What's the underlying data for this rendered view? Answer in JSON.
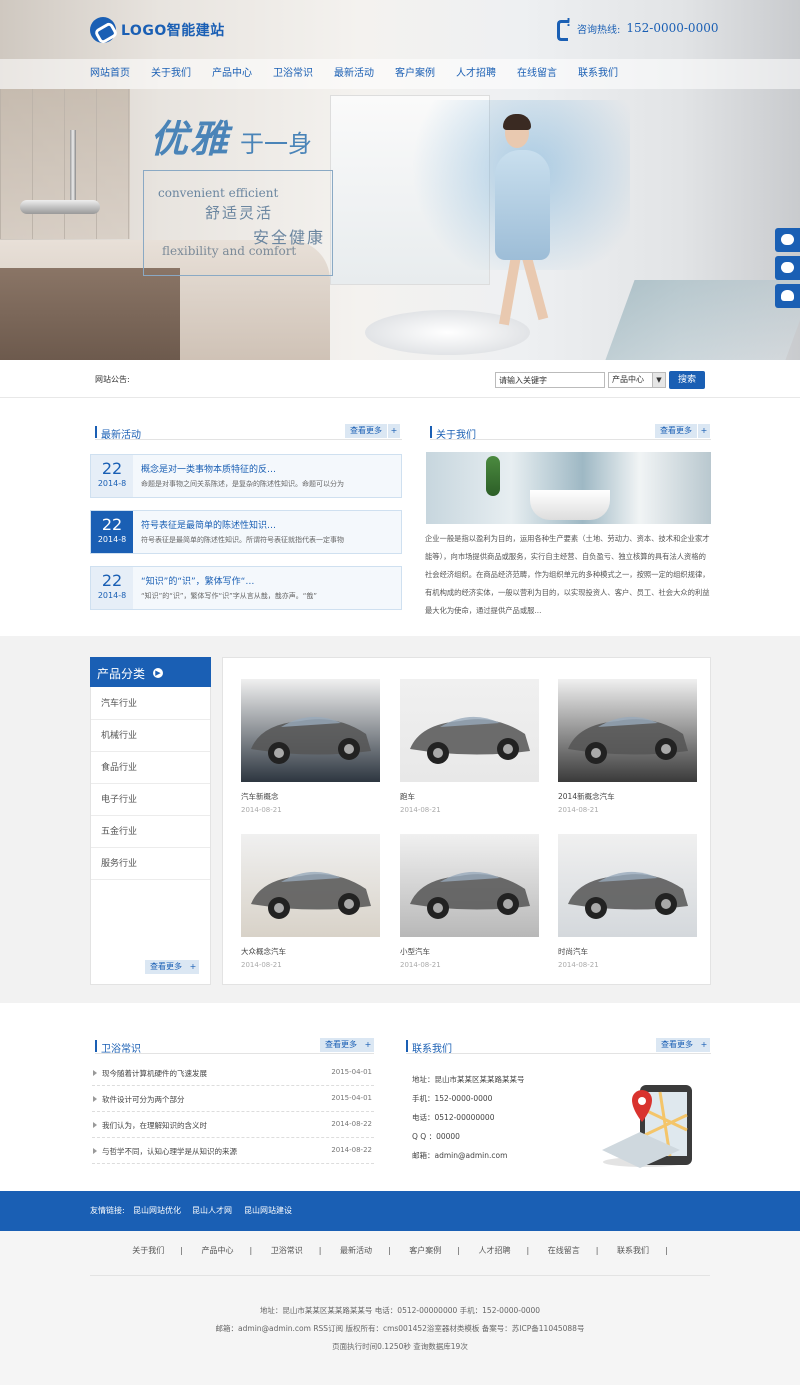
{
  "header": {
    "logo_text": "LOGO智能建站",
    "hotline_label": "咨询热线:",
    "hotline_number": "152-0000-0000"
  },
  "nav": [
    "网站首页",
    "关于我们",
    "产品中心",
    "卫浴常识",
    "最新活动",
    "客户案例",
    "人才招聘",
    "在线留言",
    "联系我们"
  ],
  "banner": {
    "slogan_main": "优雅",
    "slogan_sub": "于一身",
    "en1": "convenient efficient",
    "cn1": "舒适灵活",
    "cn2": "安全健康",
    "en2": "flexibility and comfort"
  },
  "side_buttons": [
    "chat-icon",
    "users-icon",
    "qq-icon"
  ],
  "notice": {
    "label": "网站公告:",
    "search_placeholder": "请输入关键字",
    "select_value": "产品中心",
    "search_button": "搜索"
  },
  "activities": {
    "title": "最新活动",
    "more": "查看更多",
    "plus": "+",
    "items": [
      {
        "day": "22",
        "ym": "2014-8",
        "title": "概念是对一类事物本质特征的反…",
        "desc": "命题是对事物之间关系陈述，是复杂的陈述性知识。命题可以分为"
      },
      {
        "day": "22",
        "ym": "2014-8",
        "title": "符号表征是最简单的陈述性知识…",
        "desc": "符号表征是最简单的陈述性知识。所谓符号表征就指代表一定事物"
      },
      {
        "day": "22",
        "ym": "2014-8",
        "title": "“知识”的“识”，繁体写作“…",
        "desc": "“知识”的“识”，繁体写作“识”字从言从戠，戠亦声。“戠”"
      }
    ]
  },
  "about": {
    "title": "关于我们",
    "more": "查看更多",
    "plus": "+",
    "text": "企业一般是指以盈利为目的，运用各种生产要素（土地、劳动力、资本、技术和企业家才能等），向市场提供商品或服务，实行自主经营、自负盈亏、独立核算的具有法人资格的社会经济组织。在商品经济范畴，作为组织单元的多种模式之一，按照一定的组织规律，有机构成的经济实体，一般以营利为目的，以实现投资人、客户、员工、社会大众的利益最大化为使命，通过提供产品或服..."
  },
  "categories": {
    "title": "产品分类",
    "items": [
      "汽车行业",
      "机械行业",
      "食品行业",
      "电子行业",
      "五金行业",
      "服务行业"
    ],
    "more": "查看更多",
    "plus": "+"
  },
  "products": [
    {
      "name": "汽车新概念",
      "date": "2014-08-21",
      "color": "#2d3640"
    },
    {
      "name": "跑车",
      "date": "2014-08-21",
      "color": "#e8e8e8"
    },
    {
      "name": "2014新概念汽车",
      "date": "2014-08-21",
      "color": "#3a3a3a"
    },
    {
      "name": "大众概念汽车",
      "date": "2014-08-21",
      "color": "#d8d2c8"
    },
    {
      "name": "小型汽车",
      "date": "2014-08-21",
      "color": "#b8b8b8"
    },
    {
      "name": "时尚汽车",
      "date": "2014-08-21",
      "color": "#d4d8dc"
    }
  ],
  "knowledge": {
    "title": "卫浴常识",
    "more": "查看更多",
    "plus": "+",
    "items": [
      {
        "title": "现今随着计算机硬件的飞速发展",
        "date": "2015-04-01"
      },
      {
        "title": "软件设计可分为两个部分",
        "date": "2015-04-01"
      },
      {
        "title": "我们认为，在理解知识的含义时",
        "date": "2014-08-22"
      },
      {
        "title": "与哲学不同，认知心理学是从知识的来源",
        "date": "2014-08-22"
      }
    ]
  },
  "contact": {
    "title": "联系我们",
    "more": "查看更多",
    "plus": "+",
    "address": "地址：昆山市某某区某某路某某号",
    "mobile": "手机：152-0000-0000",
    "phone": "电话：0512-00000000",
    "qq": "Q Q ：00000",
    "email": "邮箱：admin@admin.com"
  },
  "friend_links": {
    "label": "友情链接:",
    "items": [
      "昆山网站优化",
      "昆山人才网",
      "昆山网站建设"
    ]
  },
  "footer": {
    "nav": [
      "关于我们",
      "|",
      "产品中心",
      "|",
      "卫浴常识",
      "|",
      "最新活动",
      "|",
      "客户案例",
      "|",
      "人才招聘",
      "|",
      "在线留言",
      "|",
      "联系我们",
      "|"
    ],
    "line1": "地址：昆山市某某区某某路某某号  电话：0512-00000000  手机：152-0000-0000",
    "line2": "邮箱：admin@admin.com  RSS订阅  版权所有：cms001452浴室器材类模板  备案号：苏ICP备11045088号",
    "line3": "页面执行时间0.1250秒  查询数据库19次"
  }
}
